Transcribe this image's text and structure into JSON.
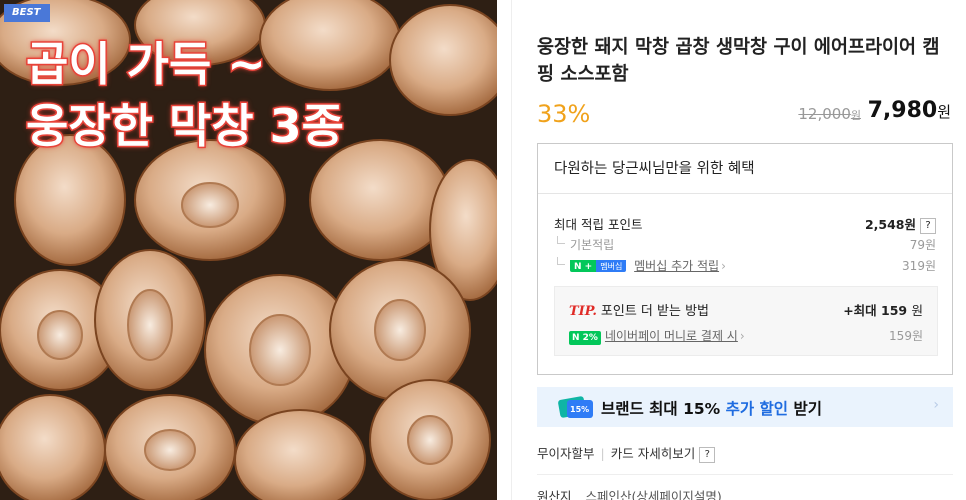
{
  "image": {
    "badge": "BEST",
    "overlay_line1": "곱이 가득 ~",
    "overlay_line2": "웅장한 막창 3종"
  },
  "product": {
    "title": "웅장한 돼지 막창 곱창 생막창 구이 에어프라이어 캠핑 소스포함",
    "discount": "33%",
    "original_price": "12,000",
    "original_price_unit": "원",
    "price": "7,980",
    "price_unit": "원"
  },
  "benefit": {
    "header": "다원하는 당근씨님만을 위한 혜택",
    "max_points_label": "최대 적립 포인트",
    "max_points_value": "2,548원",
    "help_icon": "?",
    "basic_label": "기본적립",
    "basic_value": "79원",
    "member_badge_n": "N +",
    "member_badge_text": "멤버십",
    "member_label": "멤버십 추가 적립",
    "member_value": "319원",
    "tip_tag": "TIP.",
    "tip_title": "포인트 더 받는 방법",
    "tip_max_prefix": "+최대 159",
    "tip_max_unit": "원",
    "pay_badge": "N 2%",
    "pay_label": "네이버페이 머니로 결제 시",
    "pay_value": "159원"
  },
  "brand_banner": {
    "text_prefix": "브랜드 최대 15%",
    "text_highlight": "추가 할인",
    "text_suffix": "받기",
    "icon_label": "15%"
  },
  "card": {
    "installment": "무이자할부",
    "detail": "카드 자세히보기",
    "help": "?"
  },
  "origin": {
    "label": "원산지",
    "value": "스페인산(상세페이지설명)"
  },
  "colors": {
    "discount": "#f0a21b",
    "overlay_stroke": "#e8443a",
    "naver_green": "#03c75a",
    "brand_blue": "#1f6ce0",
    "banner_bg": "#eaf3fd"
  }
}
